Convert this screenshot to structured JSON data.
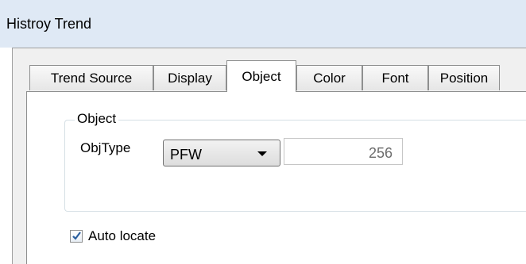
{
  "window": {
    "title": "Histroy Trend"
  },
  "tabs": [
    {
      "label": "Trend Source"
    },
    {
      "label": "Display"
    },
    {
      "label": "Object",
      "active": true
    },
    {
      "label": "Color"
    },
    {
      "label": "Font"
    },
    {
      "label": "Position"
    }
  ],
  "object_group": {
    "title": "Object",
    "objtype_label": "ObjType",
    "objtype_value": "PFW",
    "address_value": "256"
  },
  "auto_locate": {
    "label": "Auto locate",
    "checked": true
  },
  "colors": {
    "titlebar": "#dfe9f5",
    "dialog_bg": "#f0f0f0",
    "check_color": "#2b5f9e"
  }
}
